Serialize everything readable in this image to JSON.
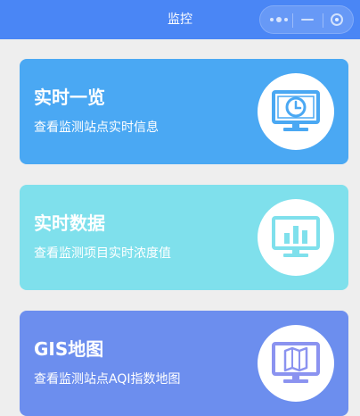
{
  "header": {
    "title": "监控",
    "background": "#4a86f5"
  },
  "menu_capsule": {
    "more_icon": "more-dots-icon",
    "minimize_icon": "minimize-icon",
    "close_icon": "close-circle-icon"
  },
  "cards": [
    {
      "title": "实时一览",
      "subtitle": "查看监测站点实时信息",
      "color": "#4aa8f3",
      "icon": "monitor-clock-icon"
    },
    {
      "title": "实时数据",
      "subtitle": "查看监测项目实时浓度值",
      "color": "#7fe0ec",
      "icon": "monitor-bar-chart-icon"
    },
    {
      "title": "GIS地图",
      "subtitle": "查看监测站点AQI指数地图",
      "color": "#6c8eee",
      "icon": "monitor-map-icon"
    }
  ]
}
